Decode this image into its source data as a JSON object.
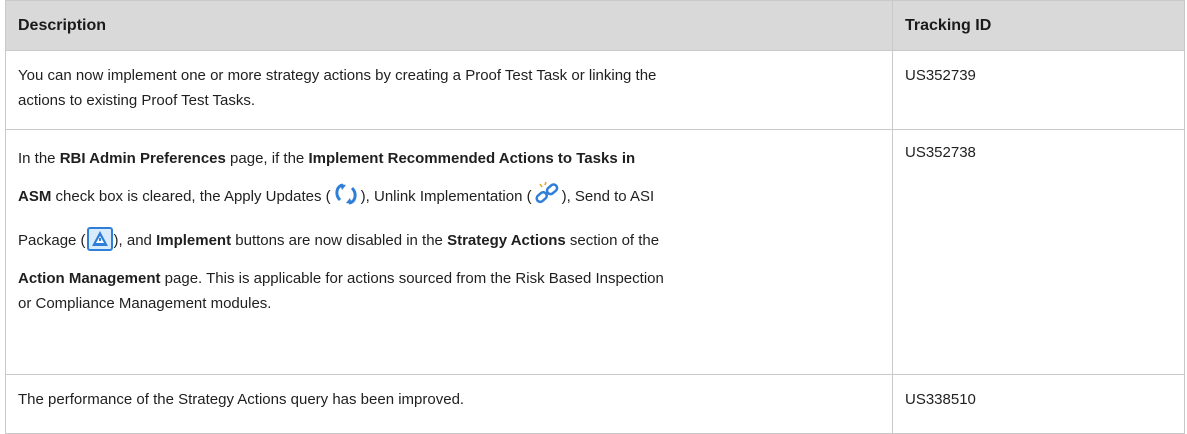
{
  "table": {
    "headers": {
      "description": "Description",
      "tracking_id": "Tracking ID"
    },
    "rows": [
      {
        "description": {
          "line1": "You can now implement one or more strategy actions by creating a Proof Test Task or linking the",
          "line2": "actions to existing Proof Test Tasks."
        },
        "tracking_id": "US352739"
      },
      {
        "description": {
          "t1": "In the ",
          "b1": "RBI Admin Preferences",
          "t2": " page, if the ",
          "b2": "Implement Recommended Actions to Tasks in",
          "b3": "ASM",
          "t3": " check box is cleared, the Apply Updates (",
          "t4": "), Unlink Implementation (",
          "t5": "), Send to ASI",
          "t6": "Package (",
          "t7": "), and ",
          "b4": "Implement",
          "t8": " buttons are now disabled in the ",
          "b5": "Strategy Actions",
          "t9": " section of the",
          "b6": "Action Management",
          "t10": " page. This is applicable for actions sourced from the Risk Based Inspection",
          "t11": "or Compliance Management modules."
        },
        "icons": [
          "apply-updates-icon",
          "unlink-implementation-icon",
          "send-to-asi-package-icon"
        ],
        "tracking_id": "US352738"
      },
      {
        "description": {
          "line1": "The performance of the Strategy Actions query has been improved."
        },
        "tracking_id": "US338510"
      }
    ]
  },
  "colors": {
    "header_bg": "#d9d9d9",
    "border": "#c9c9c9",
    "icon_blue": "#2f7fd8"
  }
}
